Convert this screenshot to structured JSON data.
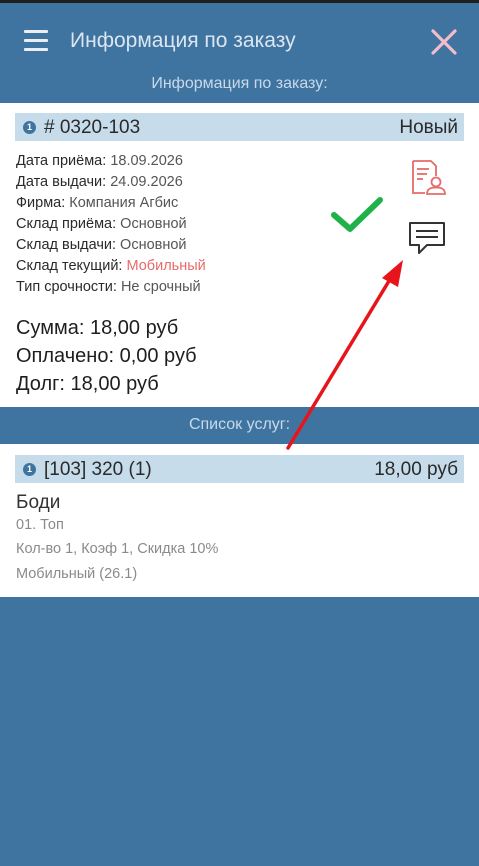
{
  "app_bar": {
    "title": "Информация по заказу",
    "menu_icon": "hamburger-menu-icon",
    "close_icon": "close-x-icon",
    "close_color": "#f0b8c8"
  },
  "order_section": {
    "header": "Информация по заказу:",
    "index": "1",
    "order_number": "# 0320-103",
    "status": "Новый",
    "details": [
      {
        "label": "Дата приёма:",
        "value": "18.09.2026"
      },
      {
        "label": "Дата выдачи:",
        "value": "24.09.2026"
      },
      {
        "label": "Фирма:",
        "value": "Компания Агбис"
      },
      {
        "label": "Склад приёма:",
        "value": "Основной"
      },
      {
        "label": "Склад выдачи:",
        "value": "Основной"
      },
      {
        "label": "Склад текущий:",
        "value": "Мобильный",
        "highlight": true
      },
      {
        "label": "Тип срочности:",
        "value": "Не срочный"
      }
    ],
    "totals": [
      {
        "label": "Сумма:",
        "value": "18,00 руб"
      },
      {
        "label": "Оплачено:",
        "value": "0,00 руб"
      },
      {
        "label": "Долг:",
        "value": "18,00 руб"
      }
    ],
    "icons": {
      "document_person": "document-person-icon",
      "checkmark": "green-checkmark-icon",
      "comment": "comment-message-icon"
    }
  },
  "services_section": {
    "header": "Список услуг:",
    "items": [
      {
        "index": "1",
        "title": "[103] 320 (1)",
        "price": "18,00 руб",
        "name": "Боди",
        "sub1": "01. Топ",
        "sub2": "Кол-во 1, Коэф 1, Скидка 10%",
        "sub3": "Мобильный (26.1)"
      }
    ]
  },
  "annotation": {
    "arrow_icon": "red-arrow-annotation",
    "color": "#e8141c"
  },
  "colors": {
    "primary": "#3f74a0",
    "strip": "#c6dceb",
    "accent_red": "#e86a6a",
    "check_green": "#1fb24a"
  }
}
